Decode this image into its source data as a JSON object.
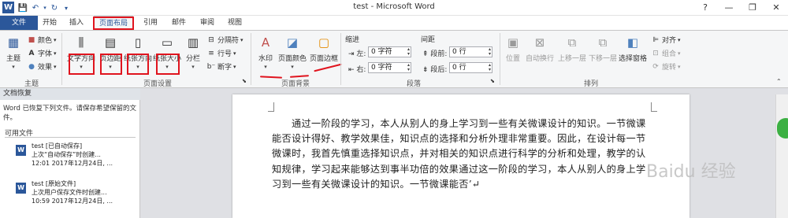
{
  "titlebar": {
    "title": "test - Microsoft Word",
    "app_logo": "W",
    "qat": {
      "save_icon": "save-icon",
      "undo_icon": "undo-icon",
      "redo_icon": "redo-icon",
      "customize_icon": "customize-qat-icon"
    },
    "help": "?",
    "minimize": "—",
    "restore": "❐",
    "close": "✕"
  },
  "tabs": [
    "文件",
    "开始",
    "插入",
    "页面布局",
    "引用",
    "邮件",
    "审阅",
    "视图"
  ],
  "active_tab": "页面布局",
  "ribbon": {
    "themes": {
      "theme_label": "主题",
      "colors": "颜色",
      "fonts": "字体",
      "effects": "效果",
      "group": "主题"
    },
    "page_setup": {
      "direction": "文字方向",
      "margins": "页边距",
      "orientation": "纸张方向",
      "size": "纸张大小",
      "columns": "分栏",
      "breaks": "分隔符",
      "line_numbers": "行号",
      "hyphenation": "断字",
      "group": "页面设置"
    },
    "background": {
      "watermark": "水印",
      "page_color": "页面颜色",
      "page_borders": "页面边框",
      "group": "页面背景"
    },
    "paragraph": {
      "indent": "缩进",
      "left": "左:",
      "left_value": "0 字符",
      "right": "右:",
      "right_value": "0 字符",
      "spacing": "间距",
      "before": "段前:",
      "before_value": "0 行",
      "after": "段后:",
      "after_value": "0 行",
      "group": "段落"
    },
    "arrange": {
      "position": "位置",
      "wrap": "自动换行",
      "forward": "上移一层",
      "backward": "下移一层",
      "selection_pane": "选择窗格",
      "align": "对齐",
      "group_btn": "组合",
      "rotate": "旋转",
      "group": "排列"
    }
  },
  "recovery": {
    "title": "文档恢复",
    "close": "✕",
    "desc": "Word 已恢复下列文件。请保存希望保留的文件。",
    "available": "可用文件",
    "files": [
      {
        "name": "test  [已自动保存]",
        "line2": "上次“自动保存”时创建...",
        "line3": "12:01 2017年12月24日, ..."
      },
      {
        "name": "test  [原始文件]",
        "line2": "上次用户保存文件时创建...",
        "line3": "10:59 2017年12月24日, ..."
      }
    ]
  },
  "document": {
    "text": "通过一阶段的学习，本人从别人的身上学习到一些有关微课设计的知识。一节微课能否设计得好、教学效果佳，知识点的选择和分析外理非常重要。因此，在设计每一节微课时，我首先慎重选择知识点，并对相关的知识点进行科学的分析和处理，教学的认知规律，学习起来能够达到事半功倍的效果通过这一阶段的学习，本人从别人的身上学习到一些有关微课设计的知识。一节微课能否’↵"
  },
  "watermark": "Baidu 经验",
  "accent_colors": {
    "word_blue": "#2b579a",
    "annotation_red": "#e0141e"
  }
}
